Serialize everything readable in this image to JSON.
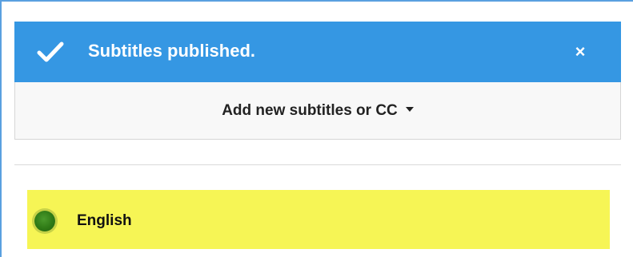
{
  "notice": {
    "message": "Subtitles published.",
    "check_icon": "checkmark-icon",
    "close_label": "×",
    "background_color": "#3597e3"
  },
  "add_subtitles": {
    "label": "Add new subtitles or CC",
    "dropdown_icon": "caret-down-icon"
  },
  "languages": [
    {
      "name": "English",
      "status_icon": "green-dot-icon",
      "status_color": "#2f7a16",
      "highlight_color": "#f6f555"
    }
  ]
}
